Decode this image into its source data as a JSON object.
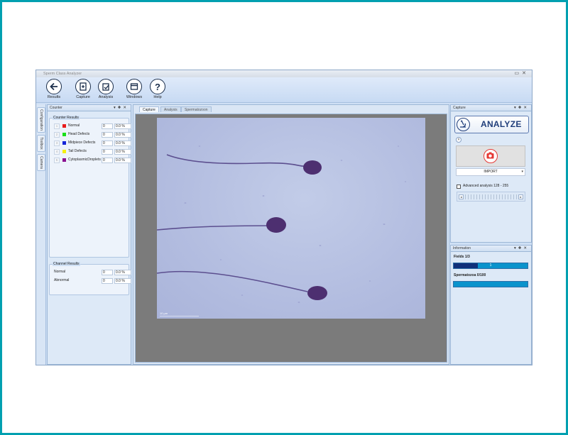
{
  "app": {
    "title": "Sperm Class Analyzer"
  },
  "ribbon": {
    "buttons": [
      {
        "label": "Results",
        "icon": "arrow-left-icon"
      },
      {
        "label": "Capture",
        "icon": "capture-icon"
      },
      {
        "label": "Analysis",
        "icon": "analysis-icon"
      },
      {
        "label": "Windows",
        "icon": "window-icon"
      },
      {
        "label": "Help",
        "icon": "help-icon"
      }
    ]
  },
  "side_tabs": [
    "Configuration",
    "Toolbox",
    "Camera"
  ],
  "counter": {
    "title": "Counter",
    "counter_results_title": "Counter Results",
    "rows": [
      {
        "index": "1",
        "name": "Normal",
        "color": "#e81c1c",
        "count": "0",
        "percent": "0.0 %"
      },
      {
        "index": "2",
        "name": "Head Defects",
        "color": "#19e019",
        "count": "0",
        "percent": "0.0 %"
      },
      {
        "index": "3",
        "name": "Midpiece Defects",
        "color": "#1525d8",
        "count": "0",
        "percent": "0.0 %"
      },
      {
        "index": "4",
        "name": "Tail Defects",
        "color": "#f5ef10",
        "count": "0",
        "percent": "0.0 %"
      },
      {
        "index": "5",
        "name": "CytoplasmicDroplets",
        "color": "#8a1090",
        "count": "0",
        "percent": "0.0 %"
      }
    ],
    "channel_results_title": "Channel Results",
    "channel_rows": [
      {
        "name": "Normal",
        "count": "0",
        "percent": "0.0 %"
      },
      {
        "name": "Abnormal",
        "count": "0",
        "percent": "0.0 %"
      }
    ]
  },
  "document_tabs": [
    "Capture",
    "Analysis",
    "Spermatozoon"
  ],
  "viewer": {
    "scale_label": "10 µm"
  },
  "capture": {
    "title": "Capture",
    "analyze_label": "ANALYZE",
    "import_label": "IMPORT",
    "advanced_label": "Advanced analysis 128 - 255",
    "advanced_checked": false
  },
  "information": {
    "title": "Information",
    "fields_label": "Fields 1/3",
    "fields_progress": 0.33,
    "fields_value": "1",
    "spermatozoa_label": "Spermatozoa 0/100",
    "spermatozoa_progress": 0
  },
  "colors": {
    "accent": "#1f3d7a",
    "progress": "#0a93cc",
    "progress_fill": "#10307a",
    "frame": "#00a0b0"
  }
}
